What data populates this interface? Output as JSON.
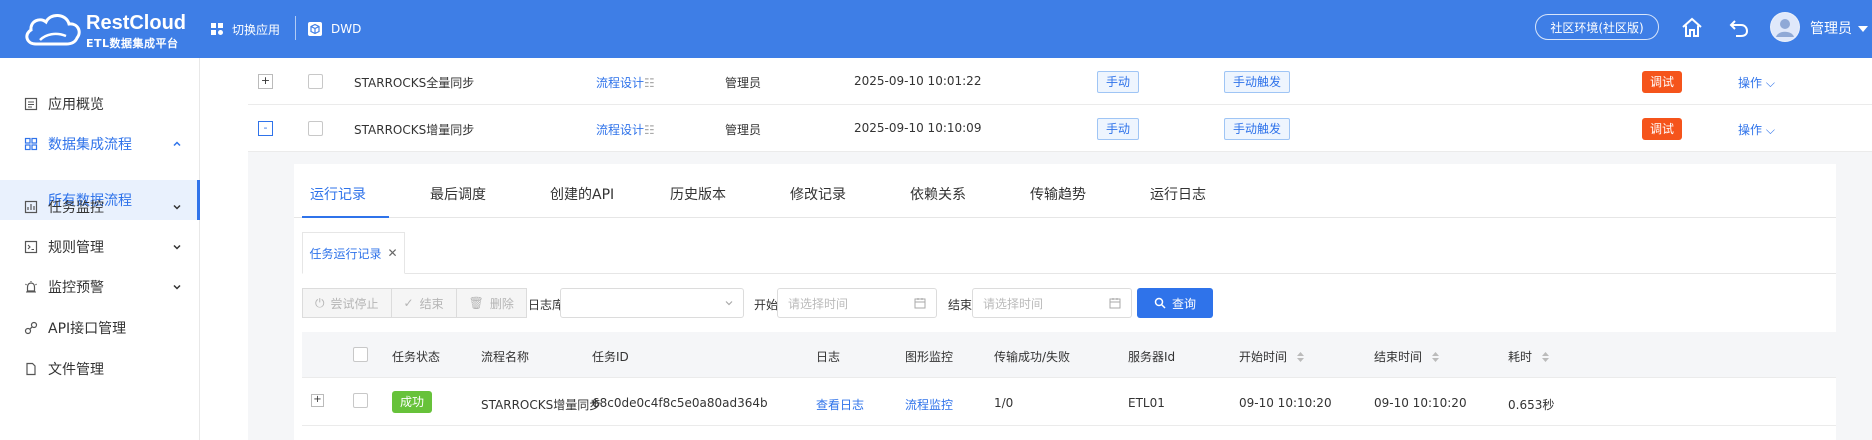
{
  "header": {
    "brand": "RestCloud",
    "brand_sub": "ETL数据集成平台",
    "switch_app": "切换应用",
    "app_name": "DWD",
    "env": "社区环境(社区版)",
    "user": "管理员",
    "color": "#3e7ee6"
  },
  "sidebar": {
    "items": [
      {
        "label": "应用概览",
        "icon": "list-icon"
      },
      {
        "label": "数据集成流程",
        "icon": "grid-icon"
      },
      {
        "label": "所有数据流程"
      },
      {
        "label": "任务监控",
        "icon": "monitor-icon"
      },
      {
        "label": "规则管理",
        "icon": "terminal-icon"
      },
      {
        "label": "监控预警",
        "icon": "alarm-icon"
      },
      {
        "label": "API接口管理",
        "icon": "api-icon"
      },
      {
        "label": "文件管理",
        "icon": "file-icon"
      }
    ]
  },
  "flows": [
    {
      "name": "STARROCKS全量同步",
      "design": "流程设计",
      "owner": "管理员",
      "time": "2025-09-10 10:01:22",
      "mode": "手动",
      "trigger": "手动触发",
      "debug": "调试",
      "ops": "操作"
    },
    {
      "name": "STARROCKS增量同步",
      "design": "流程设计",
      "owner": "管理员",
      "time": "2025-09-10 10:10:09",
      "mode": "手动",
      "trigger": "手动触发",
      "debug": "调试",
      "ops": "操作"
    }
  ],
  "detail": {
    "tabs": [
      "运行记录",
      "最后调度",
      "创建的API",
      "历史版本",
      "修改记录",
      "依赖关系",
      "传输趋势",
      "运行日志"
    ],
    "subtab": "任务运行记录",
    "toolbar": {
      "try_stop": "尝试停止",
      "finish": "结束",
      "delete": "删除",
      "log_db_label": "日志库:",
      "start_label": "开始:",
      "start_placeholder": "请选择时间",
      "end_label": "结束:",
      "end_placeholder": "请选择时间",
      "query": "查询"
    },
    "table": {
      "headers": [
        "任务状态",
        "流程名称",
        "任务ID",
        "日志",
        "图形监控",
        "传输成功/失败",
        "服务器Id",
        "开始时间",
        "结束时间",
        "耗时"
      ],
      "rows": [
        {
          "status": "成功",
          "flow": "STARROCKS增量同步",
          "task_id": "68c0de0c4f8c5e0a80ad364b",
          "log": "查看日志",
          "monitor": "流程监控",
          "transfer": "1/0",
          "server": "ETL01",
          "start": "09-10 10:10:20",
          "end": "09-10 10:10:20",
          "cost": "0.653秒"
        }
      ]
    }
  }
}
